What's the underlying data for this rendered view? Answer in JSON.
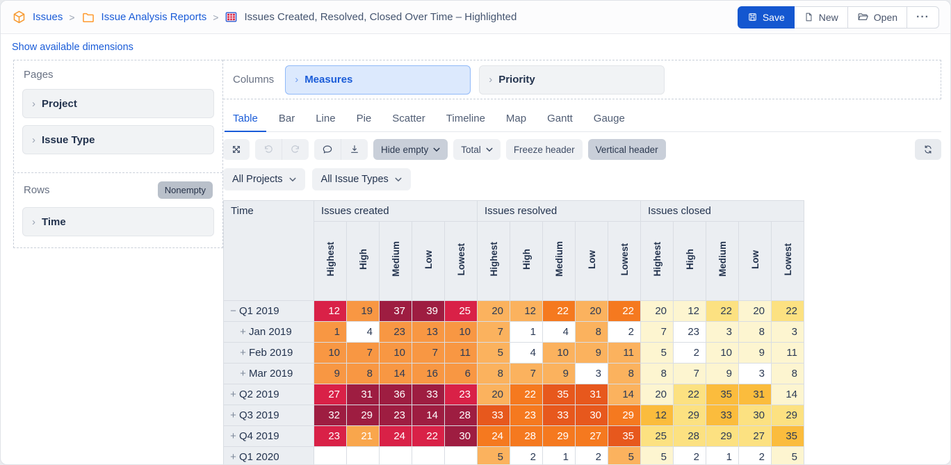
{
  "header": {
    "breadcrumb": {
      "app": "Issues",
      "separator": ">",
      "folder": "Issue Analysis Reports",
      "report": "Issues Created, Resolved, Closed Over Time – Highlighted"
    },
    "icons": {
      "app": "cube-icon",
      "folder": "folder-icon",
      "report": "report-table-icon"
    },
    "buttons": {
      "save": "Save",
      "new": "New",
      "open": "Open",
      "more": "···"
    }
  },
  "show_dimensions_link": "Show available dimensions",
  "builder": {
    "pages": {
      "label": "Pages",
      "items": [
        "Project",
        "Issue Type"
      ]
    },
    "rows": {
      "label": "Rows",
      "nonempty_button": "Nonempty",
      "items": [
        "Time"
      ]
    },
    "columns": {
      "label": "Columns",
      "items": [
        {
          "label": "Measures",
          "selected": true
        },
        {
          "label": "Priority",
          "selected": false
        }
      ]
    }
  },
  "view_tabs": {
    "active": "Table",
    "items": [
      "Table",
      "Bar",
      "Line",
      "Pie",
      "Scatter",
      "Timeline",
      "Map",
      "Gantt",
      "Gauge"
    ]
  },
  "toolbar": {
    "icons": [
      "swap-axes",
      "undo",
      "redo",
      "comment",
      "export",
      "refresh"
    ],
    "hide_empty": "Hide empty",
    "total": "Total",
    "freeze_header": "Freeze header",
    "vertical_header": "Vertical header"
  },
  "filters": {
    "projects": "All Projects",
    "issue_types": "All Issue Types"
  },
  "table": {
    "time_label": "Time",
    "groups": [
      "Issues created",
      "Issues resolved",
      "Issues closed"
    ],
    "priorities": [
      "Highest",
      "High",
      "Medium",
      "Low",
      "Lowest"
    ],
    "palette": {
      "maroon": {
        "bg": "#9e1d41",
        "fg": "#ffffff"
      },
      "crimson": {
        "bg": "#d92147",
        "fg": "#ffffff"
      },
      "orange_deep": {
        "bg": "#e7581d",
        "fg": "#ffffff"
      },
      "orange_med": {
        "bg": "#f5791f",
        "fg": "#ffffff"
      },
      "orange_created": {
        "bg": "#f89743",
        "fg": "#2b3a55"
      },
      "orange_created_white": {
        "bg": "#f9a64c",
        "fg": "#ffffff"
      },
      "orange_light": {
        "bg": "#fbb25e",
        "fg": "#2b3a55"
      },
      "amber": {
        "bg": "#fbbc3d",
        "fg": "#2b3a55"
      },
      "yellow": {
        "bg": "#fce181",
        "fg": "#2b3a55"
      },
      "cream": {
        "bg": "#fdf5d0",
        "fg": "#2b3a55"
      },
      "white": {
        "bg": "#ffffff",
        "fg": "#2b3a55"
      }
    },
    "rows": [
      {
        "label": "Q1 2019",
        "sign": "−",
        "level": 0,
        "cells": [
          [
            12,
            "crimson"
          ],
          [
            19,
            "orange_created"
          ],
          [
            37,
            "maroon"
          ],
          [
            39,
            "maroon"
          ],
          [
            25,
            "crimson"
          ],
          [
            20,
            "orange_light"
          ],
          [
            12,
            "orange_light"
          ],
          [
            22,
            "orange_med"
          ],
          [
            20,
            "orange_light"
          ],
          [
            22,
            "orange_med"
          ],
          [
            20,
            "cream"
          ],
          [
            12,
            "cream"
          ],
          [
            22,
            "yellow"
          ],
          [
            20,
            "cream"
          ],
          [
            22,
            "yellow"
          ]
        ]
      },
      {
        "label": "Jan 2019",
        "sign": "+",
        "level": 1,
        "cells": [
          [
            1,
            "orange_created"
          ],
          [
            4,
            "white"
          ],
          [
            23,
            "orange_created"
          ],
          [
            13,
            "orange_created"
          ],
          [
            10,
            "orange_created"
          ],
          [
            7,
            "orange_light"
          ],
          [
            1,
            "white"
          ],
          [
            4,
            "white"
          ],
          [
            8,
            "orange_light"
          ],
          [
            2,
            "white"
          ],
          [
            7,
            "cream"
          ],
          [
            23,
            "white"
          ],
          [
            3,
            "cream"
          ],
          [
            8,
            "cream"
          ],
          [
            3,
            "cream"
          ]
        ]
      },
      {
        "label": "Feb 2019",
        "sign": "+",
        "level": 1,
        "cells": [
          [
            10,
            "orange_created"
          ],
          [
            7,
            "orange_created"
          ],
          [
            10,
            "orange_created"
          ],
          [
            7,
            "orange_created"
          ],
          [
            11,
            "orange_created"
          ],
          [
            5,
            "orange_light"
          ],
          [
            4,
            "white"
          ],
          [
            10,
            "orange_light"
          ],
          [
            9,
            "orange_light"
          ],
          [
            11,
            "orange_light"
          ],
          [
            5,
            "cream"
          ],
          [
            2,
            "white"
          ],
          [
            10,
            "cream"
          ],
          [
            9,
            "cream"
          ],
          [
            11,
            "cream"
          ]
        ]
      },
      {
        "label": "Mar 2019",
        "sign": "+",
        "level": 1,
        "cells": [
          [
            9,
            "orange_created"
          ],
          [
            8,
            "orange_created"
          ],
          [
            14,
            "orange_created"
          ],
          [
            16,
            "orange_created"
          ],
          [
            6,
            "orange_created"
          ],
          [
            8,
            "orange_light"
          ],
          [
            7,
            "orange_light"
          ],
          [
            9,
            "orange_light"
          ],
          [
            3,
            "white"
          ],
          [
            8,
            "orange_light"
          ],
          [
            8,
            "cream"
          ],
          [
            7,
            "cream"
          ],
          [
            9,
            "cream"
          ],
          [
            3,
            "white"
          ],
          [
            8,
            "cream"
          ]
        ]
      },
      {
        "label": "Q2 2019",
        "sign": "+",
        "level": 0,
        "cells": [
          [
            27,
            "crimson"
          ],
          [
            31,
            "maroon"
          ],
          [
            36,
            "maroon"
          ],
          [
            33,
            "maroon"
          ],
          [
            23,
            "crimson"
          ],
          [
            20,
            "orange_light"
          ],
          [
            22,
            "orange_med"
          ],
          [
            35,
            "orange_deep"
          ],
          [
            31,
            "orange_deep"
          ],
          [
            14,
            "orange_light"
          ],
          [
            20,
            "cream"
          ],
          [
            22,
            "yellow"
          ],
          [
            35,
            "amber"
          ],
          [
            31,
            "amber"
          ],
          [
            14,
            "cream"
          ]
        ]
      },
      {
        "label": "Q3 2019",
        "sign": "+",
        "level": 0,
        "cells": [
          [
            32,
            "maroon"
          ],
          [
            29,
            "maroon"
          ],
          [
            23,
            "maroon"
          ],
          [
            14,
            "maroon"
          ],
          [
            28,
            "maroon"
          ],
          [
            33,
            "orange_deep"
          ],
          [
            23,
            "orange_med"
          ],
          [
            33,
            "orange_deep"
          ],
          [
            30,
            "orange_deep"
          ],
          [
            29,
            "orange_med"
          ],
          [
            12,
            "amber"
          ],
          [
            29,
            "yellow"
          ],
          [
            33,
            "amber"
          ],
          [
            30,
            "yellow"
          ],
          [
            29,
            "yellow"
          ]
        ]
      },
      {
        "label": "Q4 2019",
        "sign": "+",
        "level": 0,
        "cells": [
          [
            23,
            "crimson"
          ],
          [
            21,
            "orange_created_white"
          ],
          [
            24,
            "crimson"
          ],
          [
            22,
            "crimson"
          ],
          [
            30,
            "maroon"
          ],
          [
            24,
            "orange_med"
          ],
          [
            28,
            "orange_med"
          ],
          [
            29,
            "orange_med"
          ],
          [
            27,
            "orange_med"
          ],
          [
            35,
            "orange_deep"
          ],
          [
            25,
            "yellow"
          ],
          [
            28,
            "yellow"
          ],
          [
            29,
            "yellow"
          ],
          [
            27,
            "yellow"
          ],
          [
            35,
            "amber"
          ]
        ]
      },
      {
        "label": "Q1 2020",
        "sign": "+",
        "level": 0,
        "cells": [
          [
            "",
            "white"
          ],
          [
            "",
            "white"
          ],
          [
            "",
            "white"
          ],
          [
            "",
            "white"
          ],
          [
            "",
            "white"
          ],
          [
            5,
            "orange_light"
          ],
          [
            2,
            "white"
          ],
          [
            1,
            "white"
          ],
          [
            2,
            "white"
          ],
          [
            5,
            "orange_light"
          ],
          [
            5,
            "cream"
          ],
          [
            2,
            "white"
          ],
          [
            1,
            "white"
          ],
          [
            2,
            "white"
          ],
          [
            5,
            "cream"
          ]
        ]
      }
    ]
  }
}
